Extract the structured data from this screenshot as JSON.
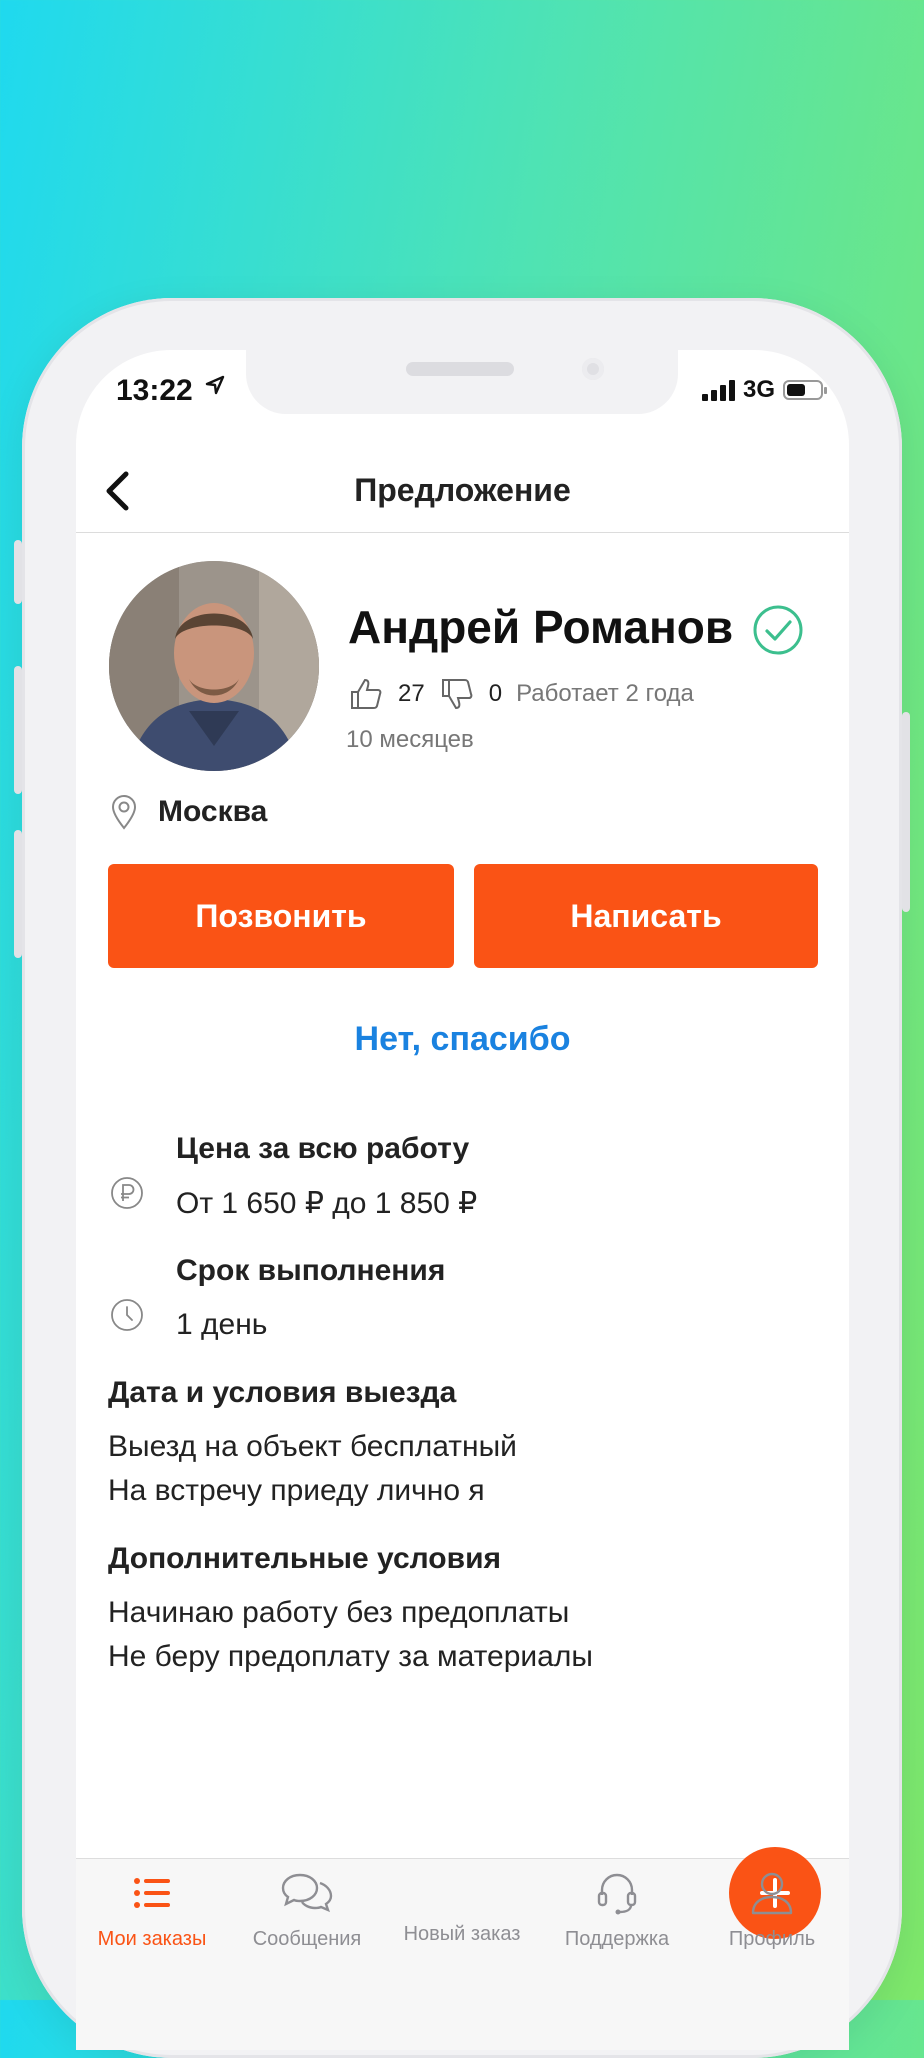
{
  "status_bar": {
    "time": "13:22",
    "network": "3G"
  },
  "header": {
    "title": "Предложение"
  },
  "profile": {
    "name": "Андрей Романов",
    "likes": "27",
    "dislikes": "0",
    "work_duration_line1": "Работает 2 года",
    "work_duration_line2": "10 месяцев",
    "city": "Москва"
  },
  "actions": {
    "call_label": "Позвонить",
    "write_label": "Написать",
    "decline_label": "Нет, спасибо"
  },
  "details": {
    "price_label": "Цена за всю работу",
    "price_value": "От 1 650 ₽ до 1 850 ₽",
    "deadline_label": "Срок выполнения",
    "deadline_value": "1 день"
  },
  "visit_section": {
    "title": "Дата и условия выезда",
    "lines": [
      "Выезд на объект бесплатный",
      "На встречу приеду лично я"
    ]
  },
  "extra_section": {
    "title": "Дополнительные условия",
    "lines": [
      "Начинаю работу без предоплаты",
      "Не беру предоплату за материалы"
    ]
  },
  "tabbar": {
    "items": [
      {
        "label": "Мои заказы",
        "icon": "list-icon",
        "active": true
      },
      {
        "label": "Сообщения",
        "icon": "chat-icon",
        "active": false
      },
      {
        "label": "Новый заказ",
        "icon": "plus-icon",
        "active": false
      },
      {
        "label": "Поддержка",
        "icon": "headset-icon",
        "active": false
      },
      {
        "label": "Профиль",
        "icon": "person-icon",
        "active": false
      }
    ]
  },
  "colors": {
    "accent": "#fa5315",
    "link": "#1a82e0",
    "verified": "#3cbf8e"
  },
  "battery_level": 0.55
}
